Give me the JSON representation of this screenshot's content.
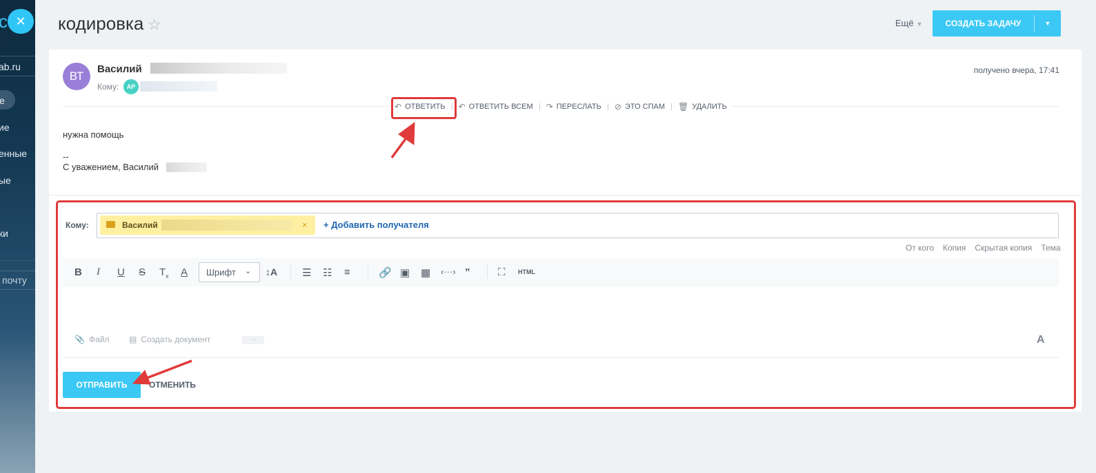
{
  "sidebar": {
    "email_fragment": "ab.ru",
    "items": [
      "е",
      "ие",
      "енные",
      "ые",
      "ки"
    ],
    "button_fragment": "почту"
  },
  "header": {
    "title": "кодировка",
    "more_label": "Ещё",
    "create_task_label": "СОЗДАТЬ ЗАДАЧУ"
  },
  "message": {
    "avatar_initials": "ВТ",
    "sender_name": "Василий",
    "to_label": "Кому:",
    "recipient_initials": "АР",
    "received": "получено вчера, 17:41",
    "actions": [
      {
        "label": "ОТВЕТИТЬ",
        "icon": "reply-icon"
      },
      {
        "label": "ОТВЕТИТЬ ВСЕМ",
        "icon": "reply-all-icon"
      },
      {
        "label": "ПЕРЕСЛАТЬ",
        "icon": "forward-icon"
      },
      {
        "label": "ЭТО СПАМ",
        "icon": "spam-icon"
      },
      {
        "label": "УДАЛИТЬ",
        "icon": "trash-icon"
      }
    ],
    "body_line1": "нужна помощь",
    "signature_dash": "--",
    "signature": "С уважением, Василий"
  },
  "compose": {
    "to_label": "Кому:",
    "recipient_chip_name": "Василий",
    "add_recipient": "Добавить получателя",
    "links": [
      "От кого",
      "Копия",
      "Скрытая копия",
      "Тема"
    ],
    "font_select_value": "Шрифт",
    "html_label": "HTML",
    "file_label": "Файл",
    "create_doc_label": "Создать документ",
    "more_dots": "···",
    "font_toggle": "A",
    "send_label": "ОТПРАВИТЬ",
    "cancel_label": "ОТМЕНИТЬ"
  },
  "colors": {
    "accent": "#3bc8f5",
    "highlight": "#e03a3a",
    "chip": "#fff0a1",
    "avatar": "#9a7fd8"
  }
}
